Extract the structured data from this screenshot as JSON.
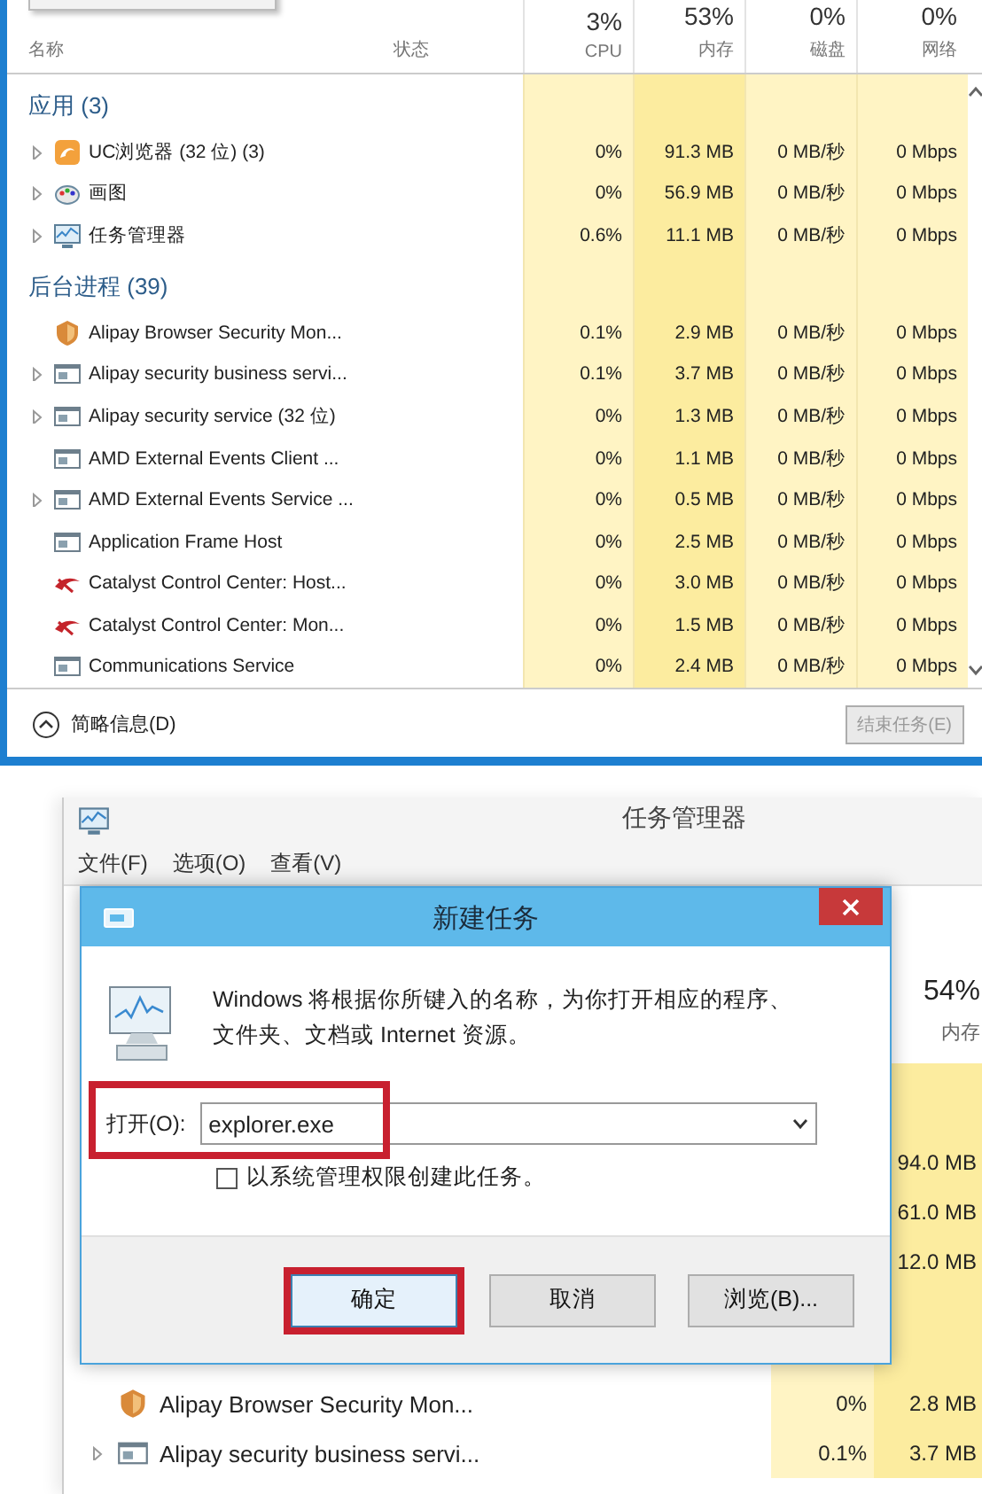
{
  "top_panel": {
    "columns": [
      {
        "label": "名称"
      },
      {
        "label": "状态"
      },
      {
        "percent": "3%",
        "label": "CPU"
      },
      {
        "percent": "53%",
        "label": "内存"
      },
      {
        "percent": "0%",
        "label": "磁盘"
      },
      {
        "percent": "0%",
        "label": "网络"
      }
    ],
    "groups": [
      {
        "title": "应用 (3)",
        "rows": [
          {
            "name": "UC浏览器 (32 位) (3)",
            "expandable": true,
            "kind": "uc",
            "cpu": "0%",
            "memory": "91.3 MB",
            "disk": "0 MB/秒",
            "network": "0 Mbps"
          },
          {
            "name": "画图",
            "expandable": true,
            "kind": "paint",
            "cpu": "0%",
            "memory": "56.9 MB",
            "disk": "0 MB/秒",
            "network": "0 Mbps"
          },
          {
            "name": "任务管理器",
            "expandable": true,
            "kind": "taskmgr",
            "cpu": "0.6%",
            "memory": "11.1 MB",
            "disk": "0 MB/秒",
            "network": "0 Mbps"
          }
        ]
      },
      {
        "title": "后台进程 (39)",
        "rows": [
          {
            "name": "Alipay Browser Security Mon...",
            "expandable": false,
            "kind": "shield",
            "cpu": "0.1%",
            "memory": "2.9 MB",
            "disk": "0 MB/秒",
            "network": "0 Mbps"
          },
          {
            "name": "Alipay security business servi...",
            "expandable": true,
            "kind": "window",
            "cpu": "0.1%",
            "memory": "3.7 MB",
            "disk": "0 MB/秒",
            "network": "0 Mbps"
          },
          {
            "name": "Alipay security service (32 位)",
            "expandable": true,
            "kind": "window",
            "cpu": "0%",
            "memory": "1.3 MB",
            "disk": "0 MB/秒",
            "network": "0 Mbps"
          },
          {
            "name": "AMD External Events Client ...",
            "expandable": false,
            "kind": "window",
            "cpu": "0%",
            "memory": "1.1 MB",
            "disk": "0 MB/秒",
            "network": "0 Mbps"
          },
          {
            "name": "AMD External Events Service ...",
            "expandable": true,
            "kind": "window",
            "cpu": "0%",
            "memory": "0.5 MB",
            "disk": "0 MB/秒",
            "network": "0 Mbps"
          },
          {
            "name": "Application Frame Host",
            "expandable": false,
            "kind": "window",
            "cpu": "0%",
            "memory": "2.5 MB",
            "disk": "0 MB/秒",
            "network": "0 Mbps"
          },
          {
            "name": "Catalyst Control Center: Host...",
            "expandable": false,
            "kind": "catalyst",
            "cpu": "0%",
            "memory": "3.0 MB",
            "disk": "0 MB/秒",
            "network": "0 Mbps"
          },
          {
            "name": "Catalyst Control Center: Mon...",
            "expandable": false,
            "kind": "catalyst",
            "cpu": "0%",
            "memory": "1.5 MB",
            "disk": "0 MB/秒",
            "network": "0 Mbps"
          },
          {
            "name": "Communications Service",
            "expandable": false,
            "kind": "window",
            "cpu": "0%",
            "memory": "2.4 MB",
            "disk": "0 MB/秒",
            "network": "0 Mbps"
          }
        ]
      }
    ],
    "footer": {
      "toggle": "简略信息(D)",
      "end_task_button": {
        "label": "结束任务(E)",
        "disabled": true
      }
    }
  },
  "task_manager_window": {
    "title": "任务管理器",
    "menu": [
      "文件(F)",
      "选项(O)",
      "查看(V)"
    ],
    "memory_header": {
      "percent": "54%",
      "label": "内存"
    },
    "memory_rows": [
      "94.0 MB",
      "61.0 MB",
      "12.0 MB"
    ],
    "rows": [
      {
        "name": "Alipay Browser Security Mon...",
        "expandable": false,
        "kind": "shield",
        "cpu": "0%",
        "memory": "2.8 MB"
      },
      {
        "name": "Alipay security business servi...",
        "expandable": true,
        "kind": "window",
        "cpu": "0.1%",
        "memory": "3.7 MB"
      }
    ]
  },
  "new_task_dialog": {
    "title": "新建任务",
    "message": "Windows 将根据你所键入的名称，为你打开相应的程序、文件夹、文档或 Internet 资源。",
    "open_label": "打开(O):",
    "open_field": {
      "value": "explorer.exe",
      "highlighted": true
    },
    "admin_checkbox": {
      "label": "以系统管理权限创建此任务。",
      "checked": false
    },
    "buttons": [
      {
        "label": "确定",
        "kind": "default",
        "highlighted": true
      },
      {
        "label": "取消",
        "kind": "normal",
        "highlighted": false
      },
      {
        "label": "浏览(B)...",
        "kind": "normal",
        "highlighted": false
      }
    ]
  }
}
